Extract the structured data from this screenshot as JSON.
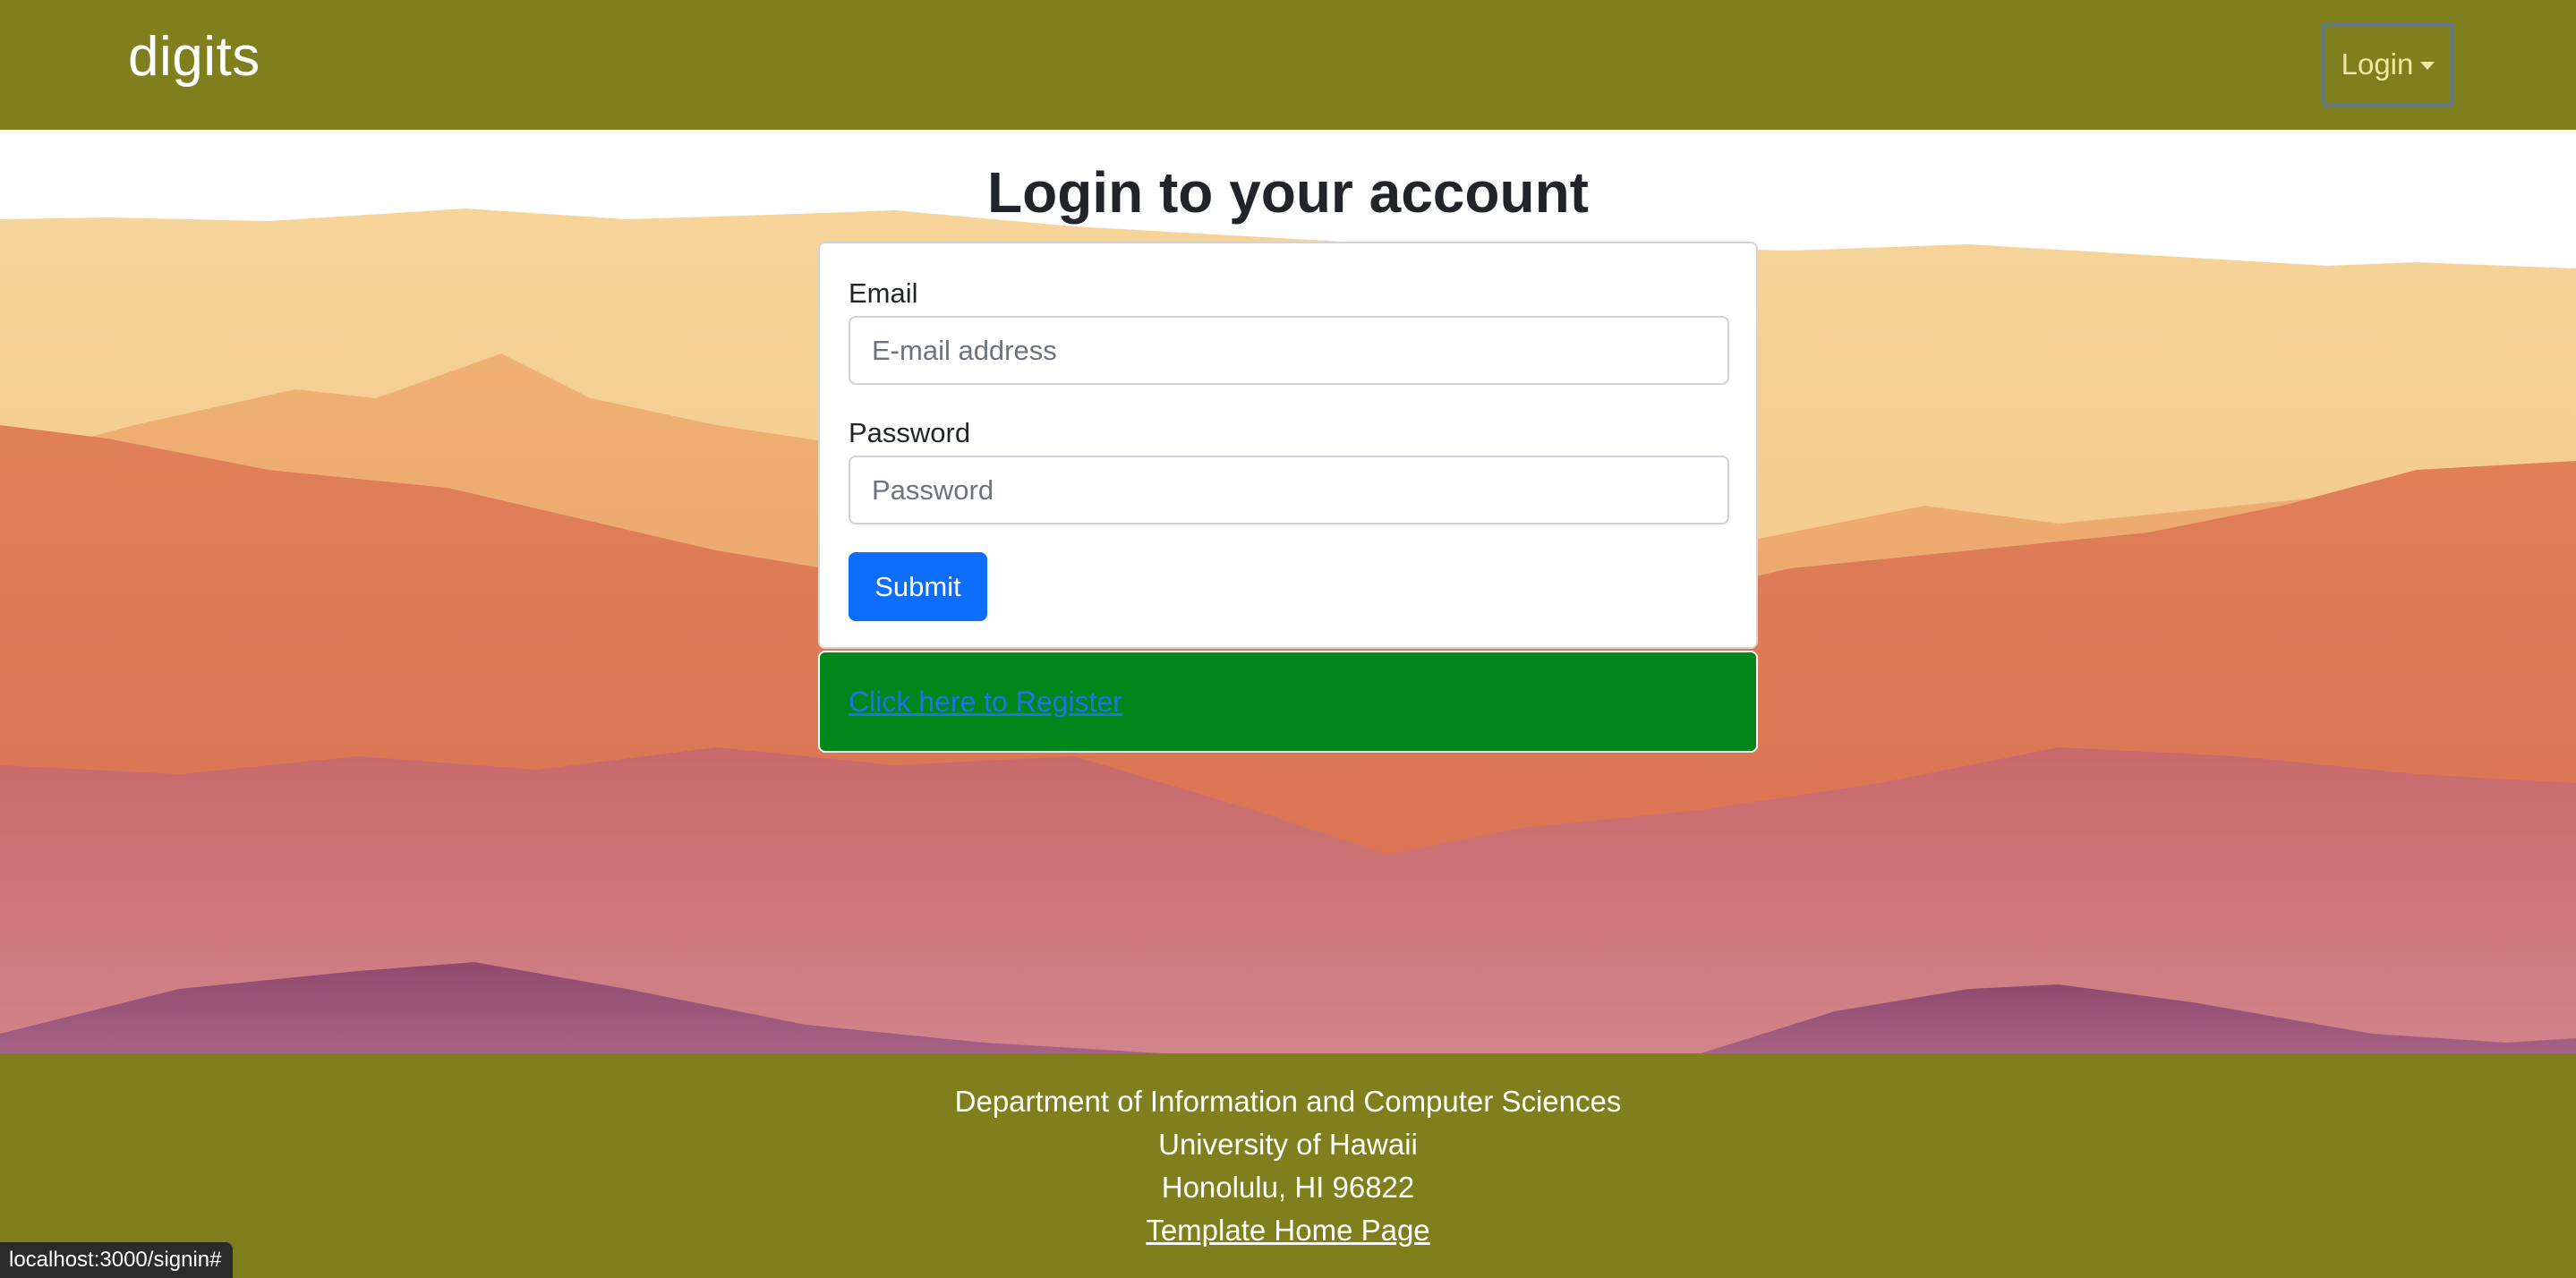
{
  "navbar": {
    "brand": "digits",
    "login_label": "Login"
  },
  "main": {
    "title": "Login to your account",
    "email_label": "Email",
    "email_placeholder": "E-mail address",
    "password_label": "Password",
    "password_placeholder": "Password",
    "submit_label": "Submit",
    "register_link": "Click here to Register"
  },
  "footer": {
    "line1": "Department of Information and Computer Sciences",
    "line2": "University of Hawaii",
    "line3": "Honolulu, HI 96822",
    "link": "Template Home Page"
  },
  "status_bar": {
    "url": "localhost:3000/signin#"
  },
  "colors": {
    "navbar": "#807f1e",
    "submit": "#0d6efd",
    "register_bg": "#008619"
  }
}
